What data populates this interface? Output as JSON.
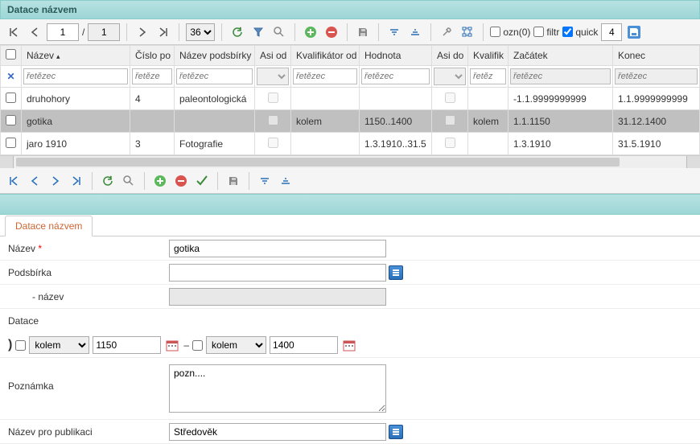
{
  "panel_title": "Datace názvem",
  "toolbar_top": {
    "page_current": "1",
    "page_sep": "/",
    "page_total": "1",
    "page_size": "36",
    "ozn_label": "ozn(0)",
    "filtr_label": "filtr",
    "quick_label": "quick",
    "num_field": "4"
  },
  "columns": {
    "c0": "",
    "c1": "Název",
    "c2": "Číslo po",
    "c3": "Název podsbírky",
    "c4": "Asi od",
    "c5": "Kvalifikátor od",
    "c6": "Hodnota",
    "c7": "Asi do",
    "c8": "Kvalifik",
    "c9": "Začátek",
    "c10": "Konec"
  },
  "filter_ph": {
    "text": "řetězec",
    "text_short": "řetěze",
    "text_short2": "řetěz"
  },
  "rows": [
    {
      "nazev": "druhohory",
      "cislo": "4",
      "podsbirka": "paleontologická",
      "asi_od": false,
      "kval_od": "",
      "hodnota": "",
      "asi_do": false,
      "kval_do": "",
      "zacatek": "-1.1.9999999999",
      "konec": "1.1.9999999999"
    },
    {
      "nazev": "gotika",
      "cislo": "",
      "podsbirka": "",
      "asi_od": false,
      "kval_od": "kolem",
      "hodnota": "1150..1400",
      "asi_do": false,
      "kval_do": "kolem",
      "zacatek": "1.1.1150",
      "konec": "31.12.1400",
      "selected": true
    },
    {
      "nazev": "jaro 1910",
      "cislo": "3",
      "podsbirka": "Fotografie",
      "asi_od": false,
      "kval_od": "",
      "hodnota": "1.3.1910..31.5",
      "asi_do": false,
      "kval_do": "",
      "zacatek": "1.3.1910",
      "konec": "31.5.1910"
    }
  ],
  "detail": {
    "tab_label": "Datace názvem",
    "label_nazev": "Název",
    "val_nazev": "gotika",
    "label_podsbirka": "Podsbírka",
    "val_podsbirka": "",
    "label_podsbirka_nazev": "- název",
    "val_podsbirka_nazev": "",
    "label_datace": "Datace",
    "kval_od": "kolem",
    "val_od": "1150",
    "dash": "–",
    "kval_do": "kolem",
    "val_do": "1400",
    "label_poznamka": "Poznámka",
    "val_poznamka": "pozn....",
    "label_pub": "Název pro publikaci",
    "val_pub": "Středověk"
  }
}
